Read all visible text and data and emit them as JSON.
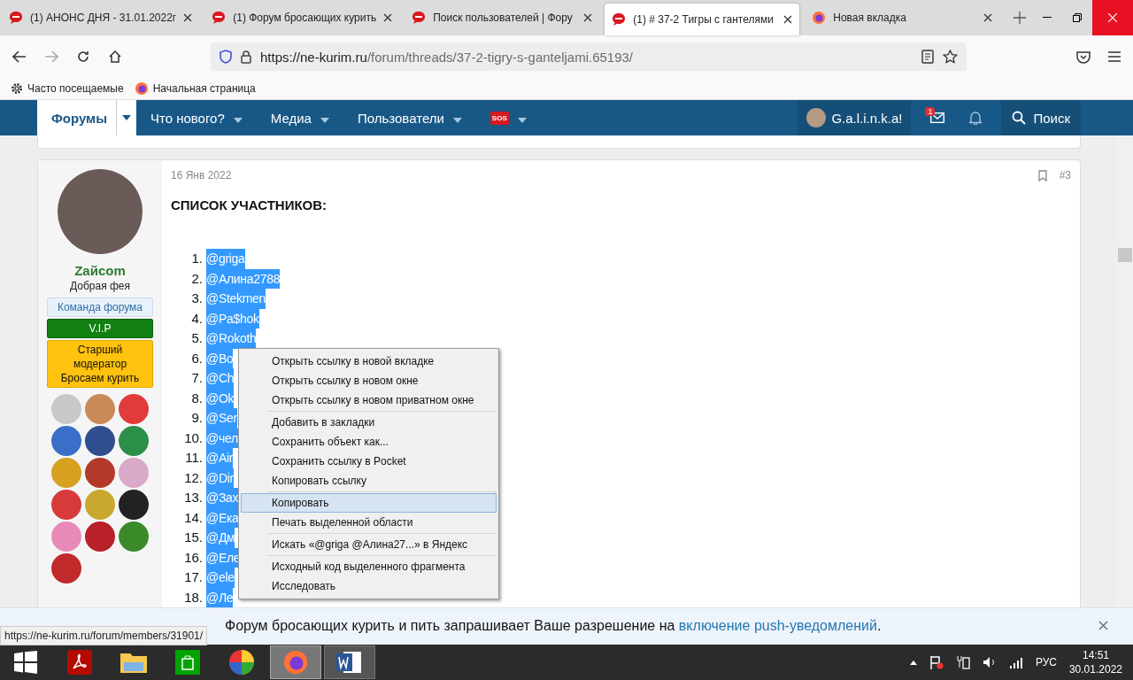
{
  "tabs": [
    {
      "title": "(1) АНОНС ДНЯ - 31.01.2022г",
      "kind": "forum",
      "selected": false
    },
    {
      "title": "(1) Форум бросающих курить",
      "kind": "forum",
      "selected": false
    },
    {
      "title": "Поиск пользователей | Фору",
      "kind": "forum",
      "selected": false
    },
    {
      "title": "(1) # 37-2 Тигры с гантелями",
      "kind": "forum",
      "selected": true
    },
    {
      "title": "Новая вкладка",
      "kind": "firefox",
      "selected": false
    }
  ],
  "address": {
    "host": "https://ne-kurim.ru",
    "path": "/forum/threads/37-2-tigry-s-ganteljami.65193/"
  },
  "bookmarks": [
    {
      "label": "Часто посещаемые",
      "kind": "gear"
    },
    {
      "label": "Начальная страница",
      "kind": "firefox"
    }
  ],
  "nav": {
    "items": [
      {
        "label": "Форумы",
        "kind": "text",
        "selected": true
      },
      {
        "label": "Что нового?",
        "kind": "text",
        "selected": false
      },
      {
        "label": "Медиа",
        "kind": "text",
        "selected": false
      },
      {
        "label": "Пользователи",
        "kind": "text",
        "selected": false
      },
      {
        "label": "SOS",
        "kind": "badge",
        "selected": false
      }
    ],
    "user": "G.a.l.i.n.k.a!",
    "inbox_count": "1",
    "search": "Поиск"
  },
  "post": {
    "author": {
      "name": "Zайcom",
      "title": "Добрая фея",
      "banners": [
        {
          "text": "Команда форума",
          "kind": "staff"
        },
        {
          "text": "V.I.P",
          "kind": "vip"
        },
        {
          "text": "Старший модератор Бросаем курить",
          "kind": "moderator"
        }
      ],
      "awards": [
        {
          "color": "#c8c8c8"
        },
        {
          "color": "#c98a5a"
        },
        {
          "color": "#e23b3b"
        },
        {
          "color": "#3a6fc9"
        },
        {
          "color": "#2f4f8f"
        },
        {
          "color": "#2b8f4a"
        },
        {
          "color": "#d8a020"
        },
        {
          "color": "#b33a2a"
        },
        {
          "color": "#d9a9c9"
        },
        {
          "color": "#d83a3a"
        },
        {
          "color": "#c9a830"
        },
        {
          "color": "#222222"
        },
        {
          "color": "#e88ab8"
        },
        {
          "color": "#b8202a"
        },
        {
          "color": "#3a8a2a"
        },
        {
          "color": "#c02a2a"
        }
      ]
    },
    "date": "16 Янв 2022",
    "number": "#3",
    "heading": "СПИСОК УЧАСТНИКОВ:",
    "members": [
      {
        "num": "1.",
        "name": "@griga"
      },
      {
        "num": "2.",
        "name": "@Алина2788"
      },
      {
        "num": "3.",
        "name": "@Stekmen"
      },
      {
        "num": "4.",
        "name": "@Pa$hok"
      },
      {
        "num": "5.",
        "name": "@Rokoth"
      },
      {
        "num": "6.",
        "name": "@Bo"
      },
      {
        "num": "7.",
        "name": "@Ch"
      },
      {
        "num": "8.",
        "name": "@Ok"
      },
      {
        "num": "9.",
        "name": "@Ser"
      },
      {
        "num": "10.",
        "name": "@чел"
      },
      {
        "num": "11.",
        "name": "@Air"
      },
      {
        "num": "12.",
        "name": "@Dir"
      },
      {
        "num": "13.",
        "name": "@Зах"
      },
      {
        "num": "14.",
        "name": "@Ека"
      },
      {
        "num": "15.",
        "name": "@Дм"
      },
      {
        "num": "16.",
        "name": "@Еле"
      },
      {
        "num": "17.",
        "name": "@ele"
      },
      {
        "num": "18.",
        "name": "@Ле"
      }
    ]
  },
  "context_menu": {
    "groups": [
      {
        "items": [
          {
            "label": "Открыть ссылку в новой вкладке",
            "selected": false
          },
          {
            "label": "Открыть ссылку в новом окне",
            "selected": false
          },
          {
            "label": "Открыть ссылку в новом приватном окне",
            "selected": false
          }
        ]
      },
      {
        "items": [
          {
            "label": "Добавить в закладки",
            "selected": false
          },
          {
            "label": "Сохранить объект как...",
            "selected": false
          },
          {
            "label": "Сохранить ссылку в Pocket",
            "selected": false
          },
          {
            "label": "Копировать ссылку",
            "selected": false
          }
        ]
      },
      {
        "items": [
          {
            "label": "Копировать",
            "selected": true
          },
          {
            "label": "Печать выделенной области",
            "selected": false
          }
        ]
      },
      {
        "items": [
          {
            "label": "Искать «@griga @Алина27...» в Яндекс",
            "selected": false
          }
        ]
      },
      {
        "items": [
          {
            "label": "Исходный код выделенного фрагмента",
            "selected": false
          },
          {
            "label": "Исследовать",
            "selected": false
          }
        ]
      }
    ]
  },
  "push_notice": {
    "text": "Форум бросающих курить и пить запрашивает Ваше разрешение на ",
    "link": "включение push-уведомлений",
    "end": "."
  },
  "status_url": "https://ne-kurim.ru/forum/members/31901/",
  "taskbar": {
    "apps": [
      {
        "kind": "start",
        "active": false,
        "running": false
      },
      {
        "kind": "pdf",
        "active": false,
        "running": false
      },
      {
        "kind": "folder",
        "active": false,
        "running": false
      },
      {
        "kind": "store",
        "active": false,
        "running": false
      },
      {
        "kind": "colors",
        "active": false,
        "running": false
      },
      {
        "kind": "firefox",
        "active": true,
        "running": true
      },
      {
        "kind": "word",
        "active": false,
        "running": true
      }
    ],
    "language": "РУС",
    "time": "14:51",
    "date": "30.01.2022"
  }
}
